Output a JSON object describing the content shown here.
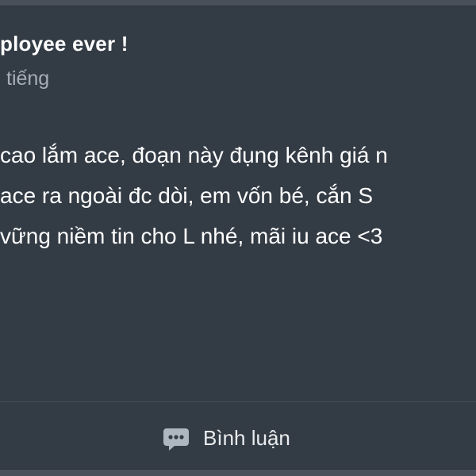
{
  "post": {
    "title": "ployee ever !",
    "subtitle": "tiếng",
    "body_lines": [
      "cao lắm ace, đoạn này đụng kênh giá n",
      " ace ra ngoài đc dòi, em vốn bé, cắn S",
      "vững niềm tin cho L nhé, mãi iu ace <3"
    ]
  },
  "actions": {
    "comment_label": "Bình luận",
    "comment_icon": "comment-bubble-icon"
  },
  "colors": {
    "page_background": "#4a5059",
    "card_background": "#333b44",
    "primary_text": "#ffffff",
    "secondary_text": "#a7aeb8",
    "icon": "#aeb6c0"
  }
}
